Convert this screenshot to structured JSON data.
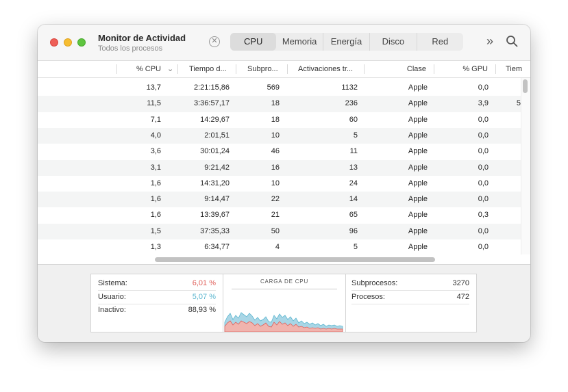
{
  "window": {
    "title": "Monitor de Actividad",
    "subtitle": "Todos los procesos"
  },
  "toolbar": {
    "stop_symbol": "✕",
    "tabs": [
      {
        "label": "CPU",
        "active": true
      },
      {
        "label": "Memoria",
        "active": false
      },
      {
        "label": "Energía",
        "active": false
      },
      {
        "label": "Disco",
        "active": false
      },
      {
        "label": "Red",
        "active": false
      }
    ],
    "more_symbol": "»"
  },
  "table": {
    "columns": [
      "% CPU",
      "Tiempo d...",
      "Subpro...",
      "Activaciones tr...",
      "Clase",
      "% GPU",
      "Tiem"
    ],
    "sort_indicator": "⌄",
    "rows": [
      {
        "cpu": "13,7",
        "time": "2:21:15,86",
        "threads": "569",
        "wakeups": "1132",
        "kind": "Apple",
        "gpu": "0,0",
        "extra": ""
      },
      {
        "cpu": "11,5",
        "time": "3:36:57,17",
        "threads": "18",
        "wakeups": "236",
        "kind": "Apple",
        "gpu": "3,9",
        "extra": "5"
      },
      {
        "cpu": "7,1",
        "time": "14:29,67",
        "threads": "18",
        "wakeups": "60",
        "kind": "Apple",
        "gpu": "0,0",
        "extra": ""
      },
      {
        "cpu": "4,0",
        "time": "2:01,51",
        "threads": "10",
        "wakeups": "5",
        "kind": "Apple",
        "gpu": "0,0",
        "extra": ""
      },
      {
        "cpu": "3,6",
        "time": "30:01,24",
        "threads": "46",
        "wakeups": "11",
        "kind": "Apple",
        "gpu": "0,0",
        "extra": ""
      },
      {
        "cpu": "3,1",
        "time": "9:21,42",
        "threads": "16",
        "wakeups": "13",
        "kind": "Apple",
        "gpu": "0,0",
        "extra": ""
      },
      {
        "cpu": "1,6",
        "time": "14:31,20",
        "threads": "10",
        "wakeups": "24",
        "kind": "Apple",
        "gpu": "0,0",
        "extra": ""
      },
      {
        "cpu": "1,6",
        "time": "9:14,47",
        "threads": "22",
        "wakeups": "14",
        "kind": "Apple",
        "gpu": "0,0",
        "extra": ""
      },
      {
        "cpu": "1,6",
        "time": "13:39,67",
        "threads": "21",
        "wakeups": "65",
        "kind": "Apple",
        "gpu": "0,3",
        "extra": ""
      },
      {
        "cpu": "1,5",
        "time": "37:35,33",
        "threads": "50",
        "wakeups": "96",
        "kind": "Apple",
        "gpu": "0,0",
        "extra": ""
      },
      {
        "cpu": "1,3",
        "time": "6:34,77",
        "threads": "4",
        "wakeups": "5",
        "kind": "Apple",
        "gpu": "0,0",
        "extra": ""
      }
    ]
  },
  "summary": {
    "system_label": "Sistema:",
    "system_value": "6,01 %",
    "user_label": "Usuario:",
    "user_value": "5,07 %",
    "idle_label": "Inactivo:",
    "idle_value": "88,93 %",
    "graph_title": "CARGA DE CPU",
    "threads_label": "Subprocesos:",
    "threads_value": "3270",
    "processes_label": "Procesos:",
    "processes_value": "472"
  },
  "colors": {
    "system": "#e0605a",
    "user": "#5bb6cf"
  }
}
